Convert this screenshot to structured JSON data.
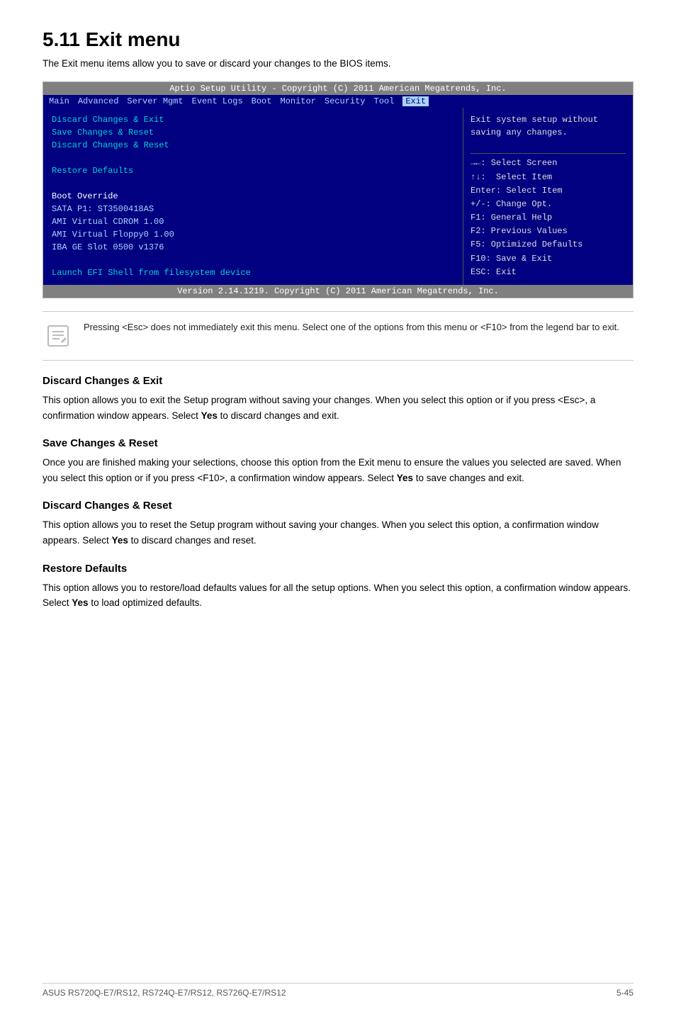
{
  "page": {
    "title": "5.11  Exit menu",
    "subtitle": "The Exit menu items allow you to save or discard your changes to the BIOS items."
  },
  "bios": {
    "title_bar": "Aptio Setup Utility - Copyright (C) 2011 American Megatrends, Inc.",
    "menu_items": [
      "Main",
      "Advanced",
      "Server Mgmt",
      "Event Logs",
      "Boot",
      "Monitor",
      "Security",
      "Tool",
      "Exit"
    ],
    "active_tab": "Exit",
    "left_items": [
      {
        "type": "menu",
        "text": "Discard Changes & Exit"
      },
      {
        "type": "menu",
        "text": "Save Changes & Reset"
      },
      {
        "type": "menu",
        "text": "Discard Changes & Reset"
      },
      {
        "type": "spacer"
      },
      {
        "type": "menu",
        "text": "Restore Defaults"
      },
      {
        "type": "spacer"
      },
      {
        "type": "label",
        "text": "Boot Override"
      },
      {
        "type": "sub",
        "text": "SATA P1: ST3500418AS"
      },
      {
        "type": "sub",
        "text": "AMI Virtual CDROM 1.00"
      },
      {
        "type": "sub",
        "text": "AMI Virtual Floppy0 1.00"
      },
      {
        "type": "sub",
        "text": "IBA GE Slot 0500 v1376"
      },
      {
        "type": "spacer"
      },
      {
        "type": "menu",
        "text": "Launch EFI Shell from filesystem device"
      }
    ],
    "right_top": "Exit system setup without\nsaving any changes.",
    "right_bottom": "→←: Select Screen\n↑↓:  Select Item\nEnter: Select Item\n+/-: Change Opt.\nF1: General Help\nF2: Previous Values\nF5: Optimized Defaults\nF10: Save & Exit\nESC: Exit",
    "footer": "Version 2.14.1219. Copyright (C) 2011 American Megatrends, Inc."
  },
  "note": {
    "text": "Pressing <Esc> does not immediately exit this menu. Select one of the options from this menu or <F10> from the legend bar to exit."
  },
  "sections": [
    {
      "id": "discard-exit",
      "heading": "Discard Changes & Exit",
      "body": "This option allows you to exit the Setup program without saving your changes. When you select this option or if you press <Esc>, a confirmation window appears. Select <b>Yes</b> to discard changes and exit."
    },
    {
      "id": "save-reset",
      "heading": "Save Changes & Reset",
      "body": "Once you are finished making your selections, choose this option from the Exit menu to ensure the values you selected are saved. When you select this option or if you press <F10>, a confirmation window appears. Select <b>Yes</b> to save changes and exit."
    },
    {
      "id": "discard-reset",
      "heading": "Discard Changes & Reset",
      "body": "This option allows you to reset the Setup program without saving your changes. When you select this option, a confirmation window appears. Select <b>Yes</b> to discard changes and reset."
    },
    {
      "id": "restore-defaults",
      "heading": "Restore Defaults",
      "body": "This option allows you to restore/load defaults values for all the setup options. When you select this option, a confirmation window appears. Select <b>Yes</b> to load optimized defaults."
    }
  ],
  "footer": {
    "left": "ASUS RS720Q-E7/RS12, RS724Q-E7/RS12, RS726Q-E7/RS12",
    "right": "5-45"
  }
}
